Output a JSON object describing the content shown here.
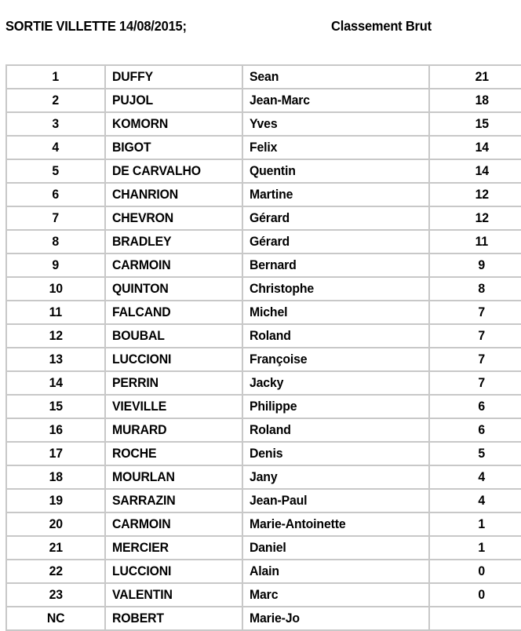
{
  "header": {
    "event_title": "SORTIE VILLETTE 14/08/2015;",
    "ranking_title": "Classement Brut"
  },
  "table": {
    "columns": [
      "rank",
      "last_name",
      "first_name",
      "score"
    ],
    "rows": [
      {
        "rank": "1",
        "last_name": "DUFFY",
        "first_name": "Sean",
        "score": "21"
      },
      {
        "rank": "2",
        "last_name": "PUJOL",
        "first_name": "Jean-Marc",
        "score": "18"
      },
      {
        "rank": "3",
        "last_name": "KOMORN",
        "first_name": "Yves",
        "score": "15"
      },
      {
        "rank": "4",
        "last_name": "BIGOT",
        "first_name": "Felix",
        "score": "14"
      },
      {
        "rank": "5",
        "last_name": "DE CARVALHO",
        "first_name": "Quentin",
        "score": "14"
      },
      {
        "rank": "6",
        "last_name": "CHANRION",
        "first_name": "Martine",
        "score": "12"
      },
      {
        "rank": "7",
        "last_name": "CHEVRON",
        "first_name": "Gérard",
        "score": "12"
      },
      {
        "rank": "8",
        "last_name": "BRADLEY",
        "first_name": "Gérard",
        "score": "11"
      },
      {
        "rank": "9",
        "last_name": "CARMOIN",
        "first_name": "Bernard",
        "score": "9"
      },
      {
        "rank": "10",
        "last_name": "QUINTON",
        "first_name": "Christophe",
        "score": "8"
      },
      {
        "rank": "11",
        "last_name": "FALCAND",
        "first_name": "Michel",
        "score": "7"
      },
      {
        "rank": "12",
        "last_name": "BOUBAL",
        "first_name": "Roland",
        "score": "7"
      },
      {
        "rank": "13",
        "last_name": "LUCCIONI",
        "first_name": "Françoise",
        "score": "7"
      },
      {
        "rank": "14",
        "last_name": "PERRIN",
        "first_name": "Jacky",
        "score": "7"
      },
      {
        "rank": "15",
        "last_name": "VIEVILLE",
        "first_name": "Philippe",
        "score": "6"
      },
      {
        "rank": "16",
        "last_name": "MURARD",
        "first_name": "Roland",
        "score": "6"
      },
      {
        "rank": "17",
        "last_name": "ROCHE",
        "first_name": "Denis",
        "score": "5"
      },
      {
        "rank": "18",
        "last_name": "MOURLAN",
        "first_name": "Jany",
        "score": "4"
      },
      {
        "rank": "19",
        "last_name": "SARRAZIN",
        "first_name": "Jean-Paul",
        "score": "4"
      },
      {
        "rank": "20",
        "last_name": "CARMOIN",
        "first_name": "Marie-Antoinette",
        "score": "1"
      },
      {
        "rank": "21",
        "last_name": "MERCIER",
        "first_name": "Daniel",
        "score": "1"
      },
      {
        "rank": "22",
        "last_name": "LUCCIONI",
        "first_name": "Alain",
        "score": "0"
      },
      {
        "rank": "23",
        "last_name": "VALENTIN",
        "first_name": "Marc",
        "score": "0"
      },
      {
        "rank": "NC",
        "last_name": "ROBERT",
        "first_name": "Marie-Jo",
        "score": ""
      }
    ]
  },
  "style": {
    "grid_line_color": "#c8c8c8",
    "text_color": "#000000",
    "background_color": "#ffffff"
  }
}
